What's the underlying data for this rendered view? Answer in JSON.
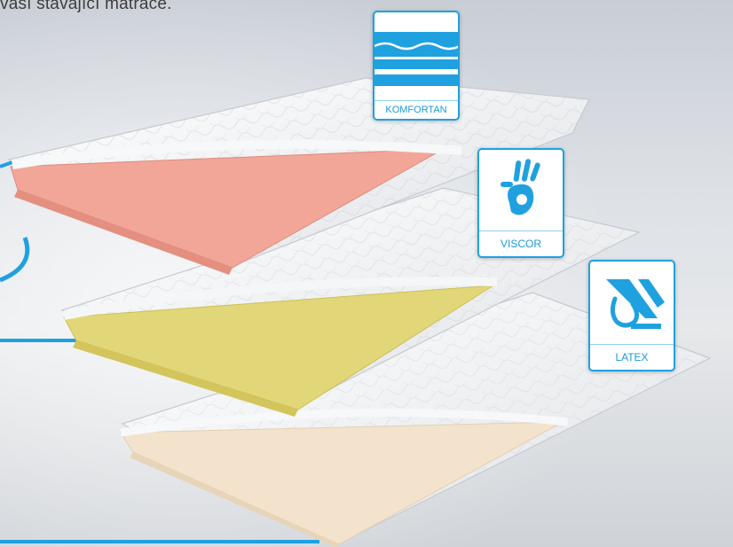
{
  "caption": {
    "text": "vaší stávající matrace."
  },
  "badges": {
    "komfortan": {
      "label": "KOMFORTAN",
      "icon": "wave-layers-icon"
    },
    "viscor": {
      "label": "VISCOR",
      "icon": "hand-print-icon"
    },
    "latex": {
      "label": "LATEX",
      "icon": "latex-drop-icon"
    }
  },
  "colors": {
    "accent": "#1fa1e0",
    "komfortan_core": "#f0a59a",
    "viscor_core": "#e4da7a",
    "latex_core": "#f6e6cf"
  }
}
